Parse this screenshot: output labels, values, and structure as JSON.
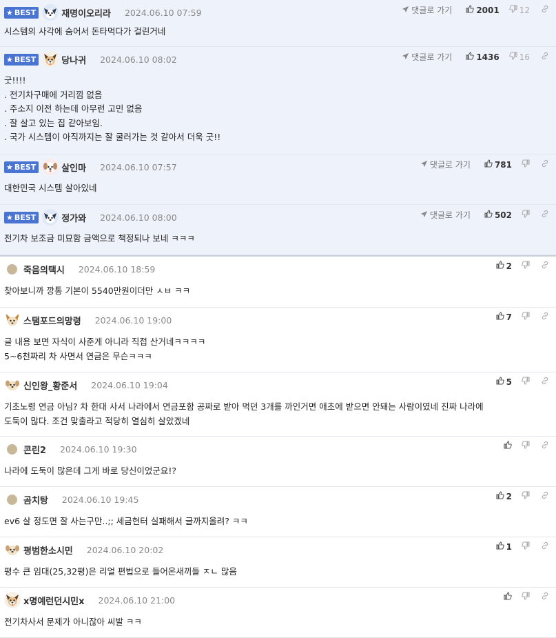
{
  "labels": {
    "best": "BEST",
    "reply": "댓글로 가기"
  },
  "comments": [
    {
      "best": true,
      "avatar": "dog-blue",
      "nick": "재명이오리라",
      "date": "2024.06.10 07:59",
      "text": "시스템의 사각에 숨어서 돈타먹다가 걸린거네",
      "up": "2001",
      "down": "12"
    },
    {
      "best": true,
      "avatar": "dog-brown",
      "nick": "당나귀",
      "date": "2024.06.10 08:02",
      "text": "굿!!!!\n. 전기차구매에 거리낌 없음\n. 주소지 이전 하는데 아무런 고민 없음\n. 잘 살고 있는 집 같아보임.\n. 국가 시스템이 아직까지는 잘 굴러가는 것 같아서 더욱 굿!!",
      "up": "1436",
      "down": "16"
    },
    {
      "best": true,
      "avatar": "dog-pink",
      "nick": "살인마",
      "date": "2024.06.10 07:57",
      "text": "대한민국 시스템 살아있네",
      "up": "781",
      "down": ""
    },
    {
      "best": true,
      "avatar": "dog-blue",
      "nick": "정가와",
      "date": "2024.06.10 08:00",
      "text": "전기차 보조금 미묘함 금액으로 책정되나 보네 ㅋㅋㅋ",
      "up": "502",
      "down": ""
    },
    {
      "best": false,
      "avatar": "dot",
      "nick": "죽음의택시",
      "date": "2024.06.10 18:59",
      "text": "찾아보니까 깡통 기본이 5540만원이더만 ㅅㅂ ㅋㅋ",
      "up": "2",
      "down": ""
    },
    {
      "best": false,
      "avatar": "fox",
      "nick": "스탬포드의망령",
      "date": "2024.06.10 19:00",
      "text": "글 내용 보면 자식이 사준게 아니라 직접 산거네ㅋㅋㅋㅋ\n5~6천짜리 차 사면서 연금은 무슨ㅋㅋㅋ",
      "up": "7",
      "down": ""
    },
    {
      "best": false,
      "avatar": "dog-tan",
      "nick": "신인왕_황준서",
      "date": "2024.06.10 19:04",
      "text": "기초노령 연금 아님? 차 한대 사서 나라에서 연금포함 공짜로 받아 먹던 3개를 까인거면 애초에 받으면 안돼는 사람이였네 진짜 나라에\n도둑이 많다. 조건 맞출라고 적당히 열심히 살았겠네",
      "up": "5",
      "down": ""
    },
    {
      "best": false,
      "avatar": "dot",
      "nick": "콘린2",
      "date": "2024.06.10 19:30",
      "text": "나라에 도둑이 많은데 그게 바로 당신이었군요!?",
      "up": "",
      "down": ""
    },
    {
      "best": false,
      "avatar": "dot",
      "nick": "곰치탕",
      "date": "2024.06.10 19:45",
      "text": "ev6 살 정도면 잘 사는구만..;; 세금헌터 실패해서 글까지올려? ㅋㅋ",
      "up": "2",
      "down": ""
    },
    {
      "best": false,
      "avatar": "dog-tan",
      "nick": "평범한소시민",
      "date": "2024.06.10 20:02",
      "text": "평수 큰 임대(25,32평)은 리얼 편법으로 들어온새끼들 ㅈㄴ 많음",
      "up": "1",
      "down": ""
    },
    {
      "best": false,
      "avatar": "dog-brown",
      "nick": "x명예런던시민x",
      "date": "2024.06.10 21:00",
      "text": "전기차사서 문제가 아니잖아 씨발 ㅋㅋ",
      "up": "",
      "down": ""
    }
  ]
}
